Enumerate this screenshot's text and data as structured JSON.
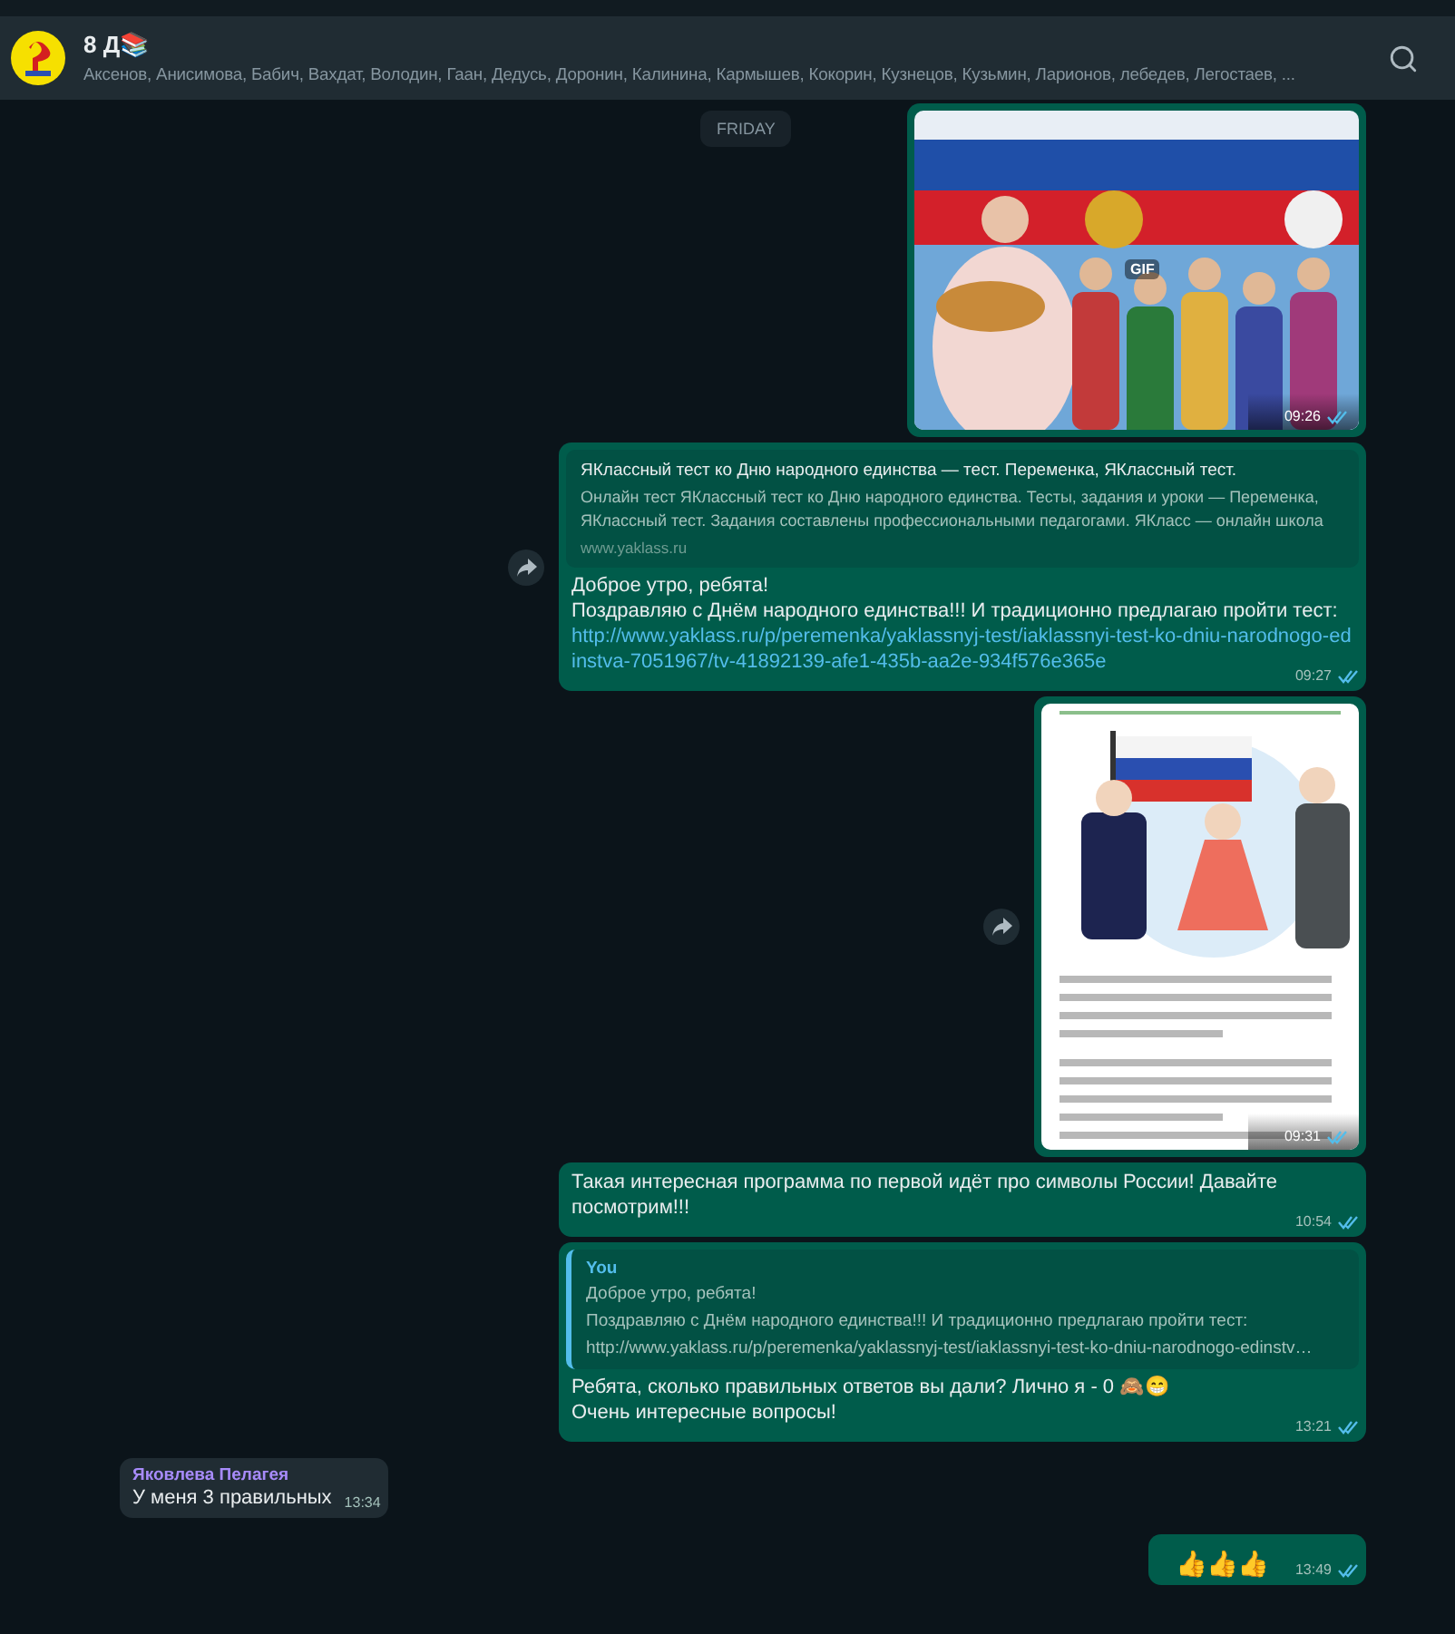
{
  "header": {
    "group_name": "8 Д📚",
    "members": "Аксенов, Анисимова, Бабич, Вахдат, Володин, Гаан, Дедусь, Доронин, Калинина, Кармышев, Кокорин, Кузнецов, Кузьмин, Ларионов, лебедев, Легостаев, ..."
  },
  "date_chip": "FRIDAY",
  "messages": [
    {
      "time": "09:26",
      "read": true,
      "share_button": false,
      "badge": "GIF"
    },
    {
      "kind": "link",
      "preview_title": "ЯКлассный тест ко Дню народного единства — тест. Переменка, ЯКлассный тест.",
      "preview_description": "Онлайн тест ЯКлассный тест ко Дню народного единства. Тесты, задания и уроки — Переменка, ЯКлассный тест. Задания составлены профессиональными педагогами. ЯКласс — онлайн школа",
      "preview_site": "www.yaklass.ru",
      "lines": [
        "Доброе утро, ребята!",
        "Поздравляю с Днём народного единства!!! И традиционно предлагаю пройти тест:"
      ],
      "url": "http://www.yaklass.ru/p/peremenka/yaklassnyj-test/iaklassnyi-test-ko-dniu-narodnogo-edinstva-7051967/tv-41892139-afe1-435b-aa2e-934f576e365e",
      "time": "09:27",
      "read": true,
      "share_button": true
    },
    {
      "time": "09:31",
      "read": true,
      "share_button": true
    },
    {
      "kind": "text",
      "lines": [
        "Такая интересная программа по первой идёт про символы России! Давайте посмотрим!!!"
      ],
      "time": "10:54",
      "read": true,
      "share_button": false
    },
    {
      "kind": "reply",
      "quote_author": "You",
      "quote_lines": [
        "Доброе утро, ребята!",
        "Поздравляю с Днём народного единства!!! И традиционно предлагаю пройти тест:",
        "http://www.yaklass.ru/p/peremenka/yaklassnyj-test/iaklassnyi-test-ko-dniu-narodnogo-edinstv…"
      ],
      "lines": [
        "Ребята, сколько правильных ответов вы дали? Лично я - 0 🙈😁",
        "Очень интересные вопросы!"
      ],
      "time": "13:21",
      "read": true,
      "share_button": false
    },
    {
      "kind": "incoming",
      "author": "Яковлева Пелагея",
      "lines": [
        "У меня 3 правильных"
      ],
      "time": "13:34"
    },
    {
      "kind": "emoji",
      "lines": [
        "👍👍👍"
      ],
      "time": "13:49",
      "read": true,
      "share_button": false
    }
  ]
}
